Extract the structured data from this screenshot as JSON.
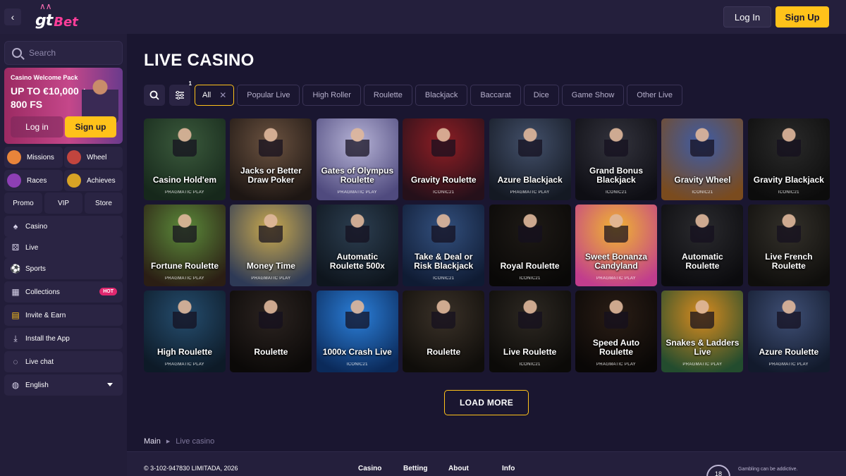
{
  "header": {
    "logo_gt": "gt",
    "logo_bet": "Bet",
    "login": "Log In",
    "signup": "Sign Up"
  },
  "sidebar": {
    "search_placeholder": "Search",
    "promo": {
      "title": "Casino Welcome Pack",
      "offer": "UP TO €10,000 + 800 FS",
      "login": "Log in",
      "signup": "Sign up"
    },
    "tiles": [
      {
        "label": "Missions",
        "color": "#e8843a"
      },
      {
        "label": "Wheel",
        "color": "#c2453e"
      },
      {
        "label": "Races",
        "color": "#8d3fb4"
      },
      {
        "label": "Achieves",
        "color": "#d8a325"
      }
    ],
    "quick": [
      "Promo",
      "VIP",
      "Store"
    ],
    "menu": [
      {
        "label": "Casino",
        "icon": "casino-icon"
      },
      {
        "label": "Live",
        "icon": "dice-icon"
      },
      {
        "label": "Sports",
        "icon": "soccer-ball-icon"
      },
      {
        "label": "Collections",
        "icon": "collections-icon",
        "badge": "HOT"
      },
      {
        "label": "Invite & Earn",
        "icon": "invite-icon"
      },
      {
        "label": "Install the App",
        "icon": "download-icon"
      },
      {
        "label": "Live chat",
        "icon": "chat-icon"
      },
      {
        "label": "English",
        "icon": "globe-icon"
      }
    ]
  },
  "main": {
    "title": "LIVE CASINO",
    "filter_badge": "1",
    "filters": [
      "All",
      "Popular Live",
      "High Roller",
      "Roulette",
      "Blackjack",
      "Baccarat",
      "Dice",
      "Game Show",
      "Other Live"
    ],
    "games": [
      {
        "title": "Casino Hold'em",
        "provider": "PRAGMATIC PLAY",
        "c1": "#3b5a3c",
        "c2": "#16281b"
      },
      {
        "title": "Jacks or Better Draw Poker",
        "provider": "",
        "c1": "#6b5240",
        "c2": "#1d1613"
      },
      {
        "title": "Gates of Olympus Roulette",
        "provider": "PRAGMATIC PLAY",
        "c1": "#b6b3d6",
        "c2": "#4f4a7e"
      },
      {
        "title": "Gravity Roulette",
        "provider": "ICONIC21",
        "c1": "#8e1e24",
        "c2": "#25101a"
      },
      {
        "title": "Azure Blackjack",
        "provider": "PRAGMATIC PLAY",
        "c1": "#43506a",
        "c2": "#141923"
      },
      {
        "title": "Grand Bonus Blackjack",
        "provider": "ICONIC21",
        "c1": "#33333d",
        "c2": "#0e0e14"
      },
      {
        "title": "Gravity Wheel",
        "provider": "ICONIC21",
        "c1": "#3d5ca7",
        "c2": "#7a4b1e"
      },
      {
        "title": "Gravity Blackjack",
        "provider": "ICONIC21",
        "c1": "#2a2a2a",
        "c2": "#0c0c0c"
      },
      {
        "title": "Fortune Roulette",
        "provider": "PRAGMATIC PLAY",
        "c1": "#5b8a3a",
        "c2": "#2b1e14"
      },
      {
        "title": "Money Time",
        "provider": "PRAGMATIC PLAY",
        "c1": "#c9a94e",
        "c2": "#2e3a56"
      },
      {
        "title": "Automatic Roulette 500x",
        "provider": "",
        "c1": "#2c3e50",
        "c2": "#0e151d"
      },
      {
        "title": "Take & Deal or Risk Blackjack",
        "provider": "ICONIC21",
        "c1": "#33507e",
        "c2": "#0f1b33"
      },
      {
        "title": "Royal Roulette",
        "provider": "ICONIC21",
        "c1": "#1e1a16",
        "c2": "#090807"
      },
      {
        "title": "Sweet Bonanza Candyland",
        "provider": "PRAGMATIC PLAY",
        "c1": "#f0b531",
        "c2": "#c13d8d"
      },
      {
        "title": "Automatic Roulette",
        "provider": "",
        "c1": "#2a2a2e",
        "c2": "#0b0b0e"
      },
      {
        "title": "Live French Roulette",
        "provider": "",
        "c1": "#33302a",
        "c2": "#0f0e0c"
      },
      {
        "title": "High Roulette",
        "provider": "PRAGMATIC PLAY",
        "c1": "#254d6e",
        "c2": "#0d1a27"
      },
      {
        "title": "Roulette",
        "provider": "",
        "c1": "#2b2320",
        "c2": "#0b0908"
      },
      {
        "title": "1000x Crash Live",
        "provider": "ICONIC21",
        "c1": "#2b7fd9",
        "c2": "#0b2a5a"
      },
      {
        "title": "Roulette",
        "provider": "",
        "c1": "#3a3128",
        "c2": "#0f0d0a"
      },
      {
        "title": "Live Roulette",
        "provider": "ICONIC21",
        "c1": "#2d2822",
        "c2": "#0b0a08"
      },
      {
        "title": "Speed Auto Roulette",
        "provider": "PRAGMATIC PLAY",
        "c1": "#2a1d15",
        "c2": "#090706"
      },
      {
        "title": "Snakes & Ladders Live",
        "provider": "PRAGMATIC PLAY",
        "c1": "#d88b1f",
        "c2": "#234c2e"
      },
      {
        "title": "Azure Roulette",
        "provider": "PRAGMATIC PLAY",
        "c1": "#3f4f75",
        "c2": "#121a2c"
      }
    ],
    "load_more": "LOAD MORE",
    "breadcrumb": {
      "home": "Main",
      "current": "Live casino"
    }
  },
  "footer": {
    "copyright": "© 3-102-947830 LIMITADA, 2026",
    "nav": [
      "Casino",
      "Betting",
      "About",
      "Info"
    ],
    "age": "18",
    "gambling": "Gambling can be addictive."
  }
}
